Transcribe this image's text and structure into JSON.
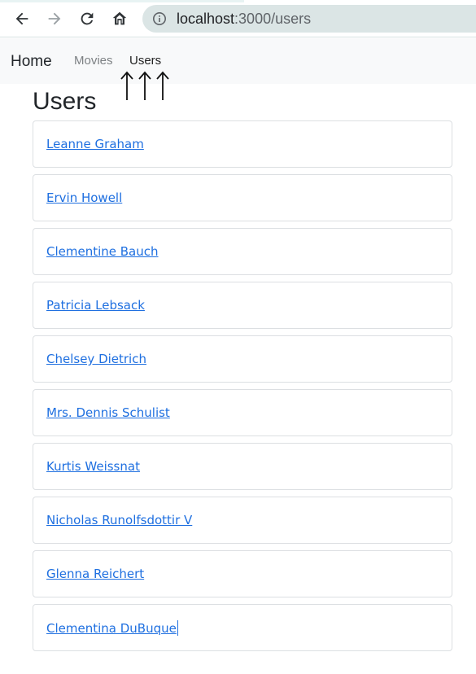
{
  "browser": {
    "url_host": "localhost",
    "url_path": ":3000/users"
  },
  "navbar": {
    "brand": "Home",
    "links": [
      {
        "label": "Movies"
      },
      {
        "label": "Users"
      }
    ]
  },
  "page": {
    "title": "Users"
  },
  "annotation": {
    "arrows": 3
  },
  "users": [
    {
      "name": "Leanne Graham"
    },
    {
      "name": "Ervin Howell"
    },
    {
      "name": "Clementine Bauch"
    },
    {
      "name": "Patricia Lebsack"
    },
    {
      "name": "Chelsey Dietrich"
    },
    {
      "name": "Mrs. Dennis Schulist"
    },
    {
      "name": "Kurtis Weissnat"
    },
    {
      "name": "Nicholas Runolfsdottir V"
    },
    {
      "name": "Glenna Reichert"
    },
    {
      "name": "Clementina DuBuque"
    }
  ],
  "colors": {
    "link": "#1e6fe0",
    "navbar_bg": "#f8f9fa",
    "omnibox_bg": "#dbe5e5"
  }
}
